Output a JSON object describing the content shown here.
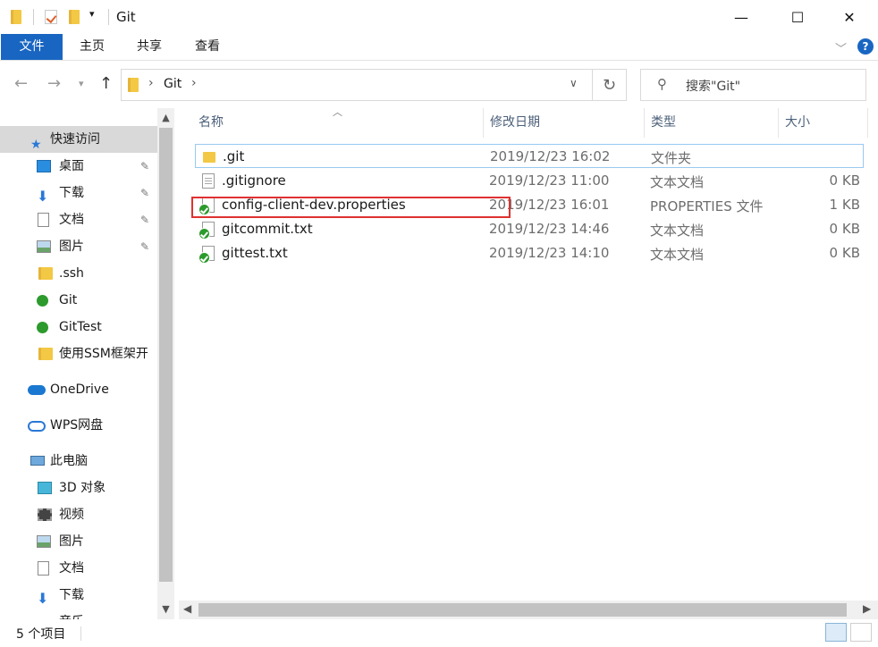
{
  "window": {
    "title": "Git"
  },
  "titlebar_buttons": {
    "minimize": "—",
    "maximize": "☐",
    "close": "✕"
  },
  "ribbon": {
    "tabs": [
      {
        "label": "文件"
      },
      {
        "label": "主页"
      },
      {
        "label": "共享"
      },
      {
        "label": "查看"
      }
    ],
    "help": "?"
  },
  "address": {
    "breadcrumb": [
      "Git"
    ],
    "search_placeholder": "搜索\"Git\""
  },
  "nav_pane": {
    "items": [
      {
        "label": "快速访问",
        "icon": "star-icon"
      },
      {
        "label": "桌面",
        "icon": "desktop-icon",
        "pinned": true
      },
      {
        "label": "下载",
        "icon": "download-icon",
        "pinned": true
      },
      {
        "label": "文档",
        "icon": "document-icon",
        "pinned": true
      },
      {
        "label": "图片",
        "icon": "picture-icon",
        "pinned": true
      },
      {
        "label": ".ssh",
        "icon": "folder-icon"
      },
      {
        "label": "Git",
        "icon": "git-folder-icon"
      },
      {
        "label": "GitTest",
        "icon": "git-folder-icon"
      },
      {
        "label": "使用SSM框架开",
        "icon": "folder-icon"
      },
      {
        "label": "OneDrive",
        "icon": "cloud-icon"
      },
      {
        "label": "WPS网盘",
        "icon": "cloud-outline-icon"
      },
      {
        "label": "此电脑",
        "icon": "computer-icon"
      },
      {
        "label": "3D 对象",
        "icon": "cube-icon"
      },
      {
        "label": "视频",
        "icon": "video-icon"
      },
      {
        "label": "图片",
        "icon": "picture-icon"
      },
      {
        "label": "文档",
        "icon": "document-icon"
      },
      {
        "label": "下载",
        "icon": "download-icon"
      },
      {
        "label": "音乐",
        "icon": "music-icon"
      }
    ]
  },
  "file_list": {
    "columns": {
      "name": "名称",
      "date": "修改日期",
      "type": "类型",
      "size": "大小"
    },
    "rows": [
      {
        "name": ".git",
        "date": "2019/12/23 16:02",
        "type": "文件夹",
        "size": "",
        "icon": "folder-icon"
      },
      {
        "name": ".gitignore",
        "date": "2019/12/23 11:00",
        "type": "文本文档",
        "size": "0 KB",
        "icon": "text-file-icon"
      },
      {
        "name": "config-client-dev.properties",
        "date": "2019/12/23 16:01",
        "type": "PROPERTIES 文件",
        "size": "1 KB",
        "icon": "git-tracked-file-icon"
      },
      {
        "name": "gitcommit.txt",
        "date": "2019/12/23 14:46",
        "type": "文本文档",
        "size": "0 KB",
        "icon": "git-tracked-file-icon"
      },
      {
        "name": "gittest.txt",
        "date": "2019/12/23 14:10",
        "type": "文本文档",
        "size": "0 KB",
        "icon": "git-tracked-file-icon"
      }
    ]
  },
  "status_bar": {
    "item_count": "5 个项目"
  },
  "colors": {
    "accent": "#1966c2",
    "highlight": "#e03131",
    "selection_border": "#99c9ef"
  }
}
